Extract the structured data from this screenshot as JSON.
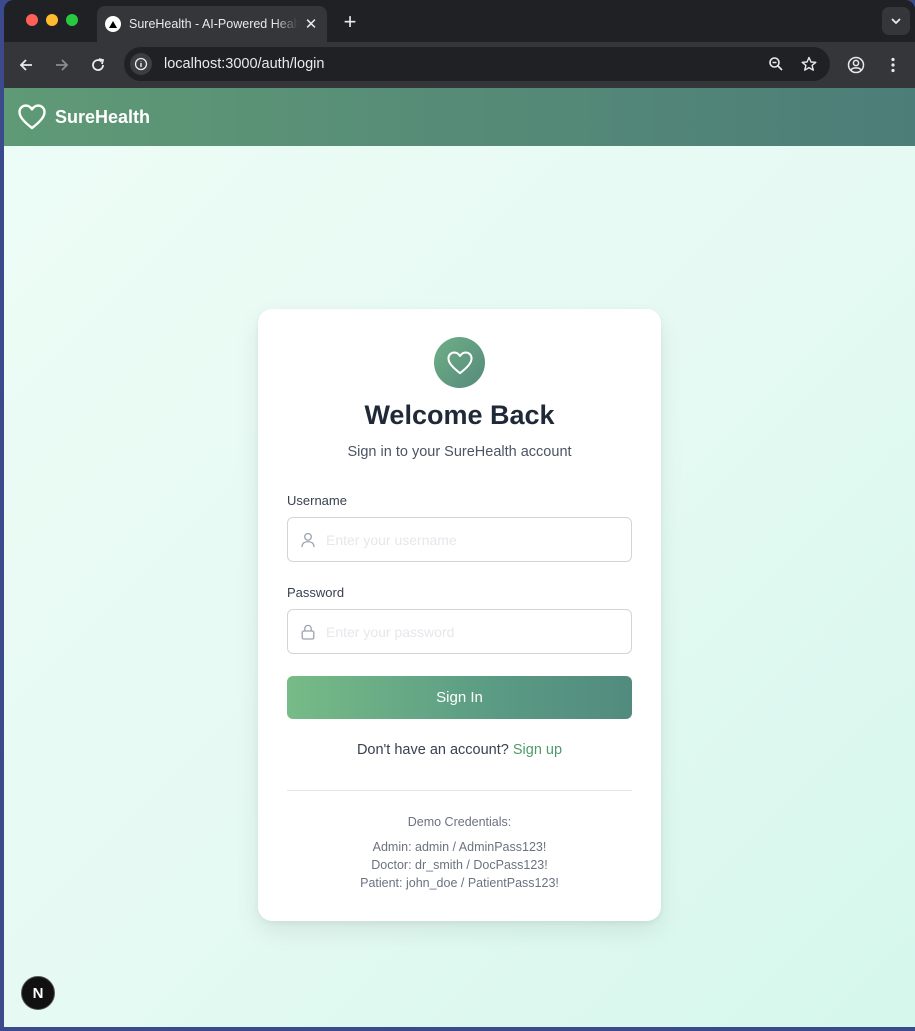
{
  "browser": {
    "tab_title": "SureHealth - AI-Powered Healthcare",
    "new_tab_label": "+",
    "url": "localhost:3000/auth/login"
  },
  "header": {
    "brand": "SureHealth",
    "brand_icon": "heart-icon"
  },
  "login": {
    "title": "Welcome Back",
    "subtitle": "Sign in to your SureHealth account",
    "username_label": "Username",
    "username_placeholder": "Enter your username",
    "username_value": "",
    "password_label": "Password",
    "password_placeholder": "Enter your password",
    "password_value": "",
    "signin_label": "Sign In",
    "no_account_text": "Don't have an account?",
    "signup_link": "Sign up"
  },
  "demo": {
    "title": "Demo Credentials:",
    "lines": [
      "Admin: admin / AdminPass123!",
      "Doctor: dr_smith / DocPass123!",
      "Patient: john_doe / PatientPass123!"
    ]
  },
  "dev_badge": "N",
  "colors": {
    "brand_green": "#5f9a76",
    "brand_teal": "#4d7d78",
    "link_green": "#4f9a6b",
    "page_bg": "#e6faf3"
  }
}
